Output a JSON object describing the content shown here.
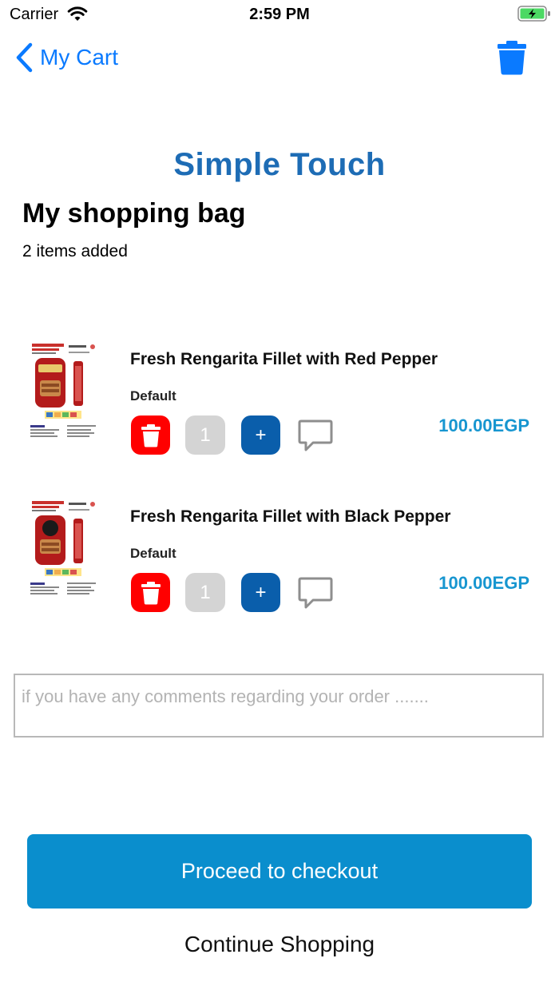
{
  "status_bar": {
    "carrier": "Carrier",
    "time": "2:59 PM"
  },
  "nav": {
    "back_label": "My Cart",
    "accent_color": "#0a7aff"
  },
  "header": {
    "brand": "Simple Touch",
    "title": "My shopping bag",
    "items_count": "2 items added"
  },
  "cart": {
    "items": [
      {
        "name": "Fresh Rengarita Fillet with Red Pepper",
        "variant": "Default",
        "quantity": "1",
        "plus_label": "+",
        "price": "100.00EGP",
        "image": "rengarita-red-pepper-package"
      },
      {
        "name": "Fresh Rengarita Fillet with Black Pepper",
        "variant": "Default",
        "quantity": "1",
        "plus_label": "+",
        "price": "100.00EGP",
        "image": "rengarita-black-pepper-package"
      }
    ]
  },
  "comments": {
    "placeholder": "if you have any comments regarding your order ......."
  },
  "actions": {
    "checkout_label": "Proceed to checkout",
    "continue_label": "Continue Shopping"
  },
  "colors": {
    "brand": "#1d6cb5",
    "delete": "#ff0000",
    "plus": "#0a5eab",
    "price": "#1796d0",
    "checkout": "#0a8ecd"
  }
}
